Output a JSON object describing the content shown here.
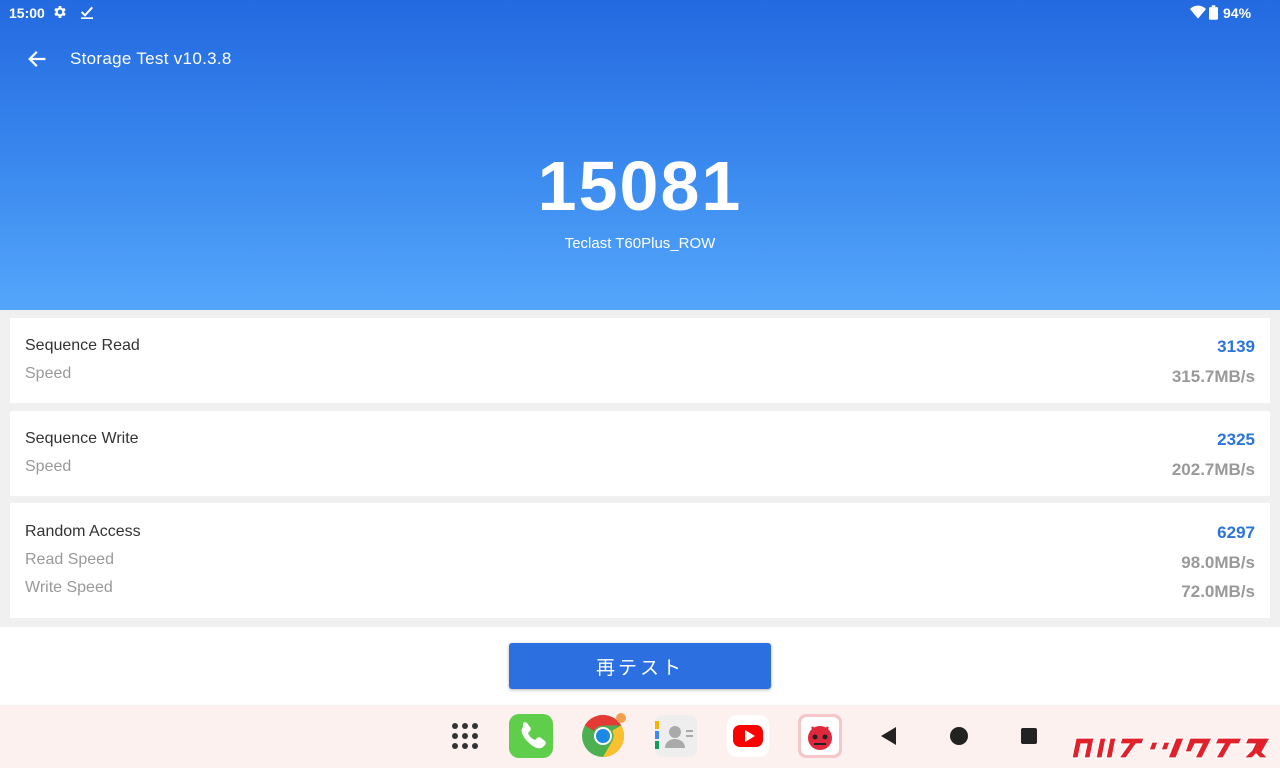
{
  "status_bar": {
    "time": "15:00",
    "battery_percent": "94%",
    "icons": [
      "gear-icon",
      "download-done-icon",
      "wifi-icon",
      "battery-icon"
    ]
  },
  "header": {
    "title": "Storage Test v10.3.8",
    "back_icon": "arrow-left-icon"
  },
  "result": {
    "total_score": "15081",
    "device": "Teclast T60Plus_ROW"
  },
  "sections": [
    {
      "label": "Sequence Read",
      "score": "3139",
      "rows": [
        {
          "label": "Speed",
          "value": "315.7MB/s"
        }
      ]
    },
    {
      "label": "Sequence Write",
      "score": "2325",
      "rows": [
        {
          "label": "Speed",
          "value": "202.7MB/s"
        }
      ]
    },
    {
      "label": "Random Access",
      "score": "6297",
      "rows": [
        {
          "label": "Read Speed",
          "value": "98.0MB/s"
        },
        {
          "label": "Write Speed",
          "value": "72.0MB/s"
        }
      ]
    }
  ],
  "retest_button": "再テスト",
  "dock": {
    "apps": [
      "app-drawer-icon",
      "phone-icon",
      "chrome-icon",
      "contacts-icon",
      "youtube-icon",
      "antutu-icon"
    ],
    "nav": [
      "back-triangle-icon",
      "home-circle-icon",
      "recents-square-icon"
    ]
  },
  "colors": {
    "header_top": "#2369e0",
    "header_bottom": "#54a6fb",
    "accent": "#2a74dc",
    "button": "#2b6fe0",
    "muted": "#999999",
    "dock_bg": "#fdf1ef"
  }
}
